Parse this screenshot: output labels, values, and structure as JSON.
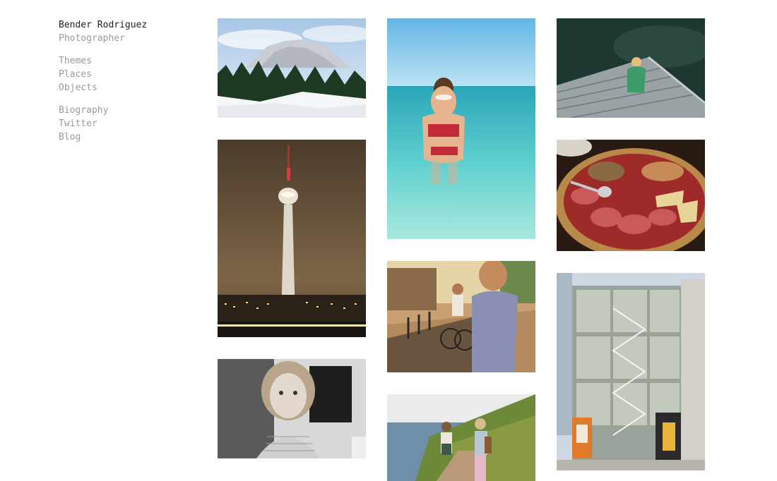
{
  "site": {
    "name": "Bender Rodriguez",
    "subtitle": "Photographer"
  },
  "nav_primary": [
    {
      "label": "Themes"
    },
    {
      "label": "Places"
    },
    {
      "label": "Objects"
    }
  ],
  "nav_secondary": [
    {
      "label": "Biography"
    },
    {
      "label": "Twitter"
    },
    {
      "label": "Blog"
    }
  ],
  "gallery": [
    {
      "subject": "snowy mountain with pine forest",
      "icon": "photo-mountain"
    },
    {
      "subject": "tv tower at night",
      "icon": "photo-tower"
    },
    {
      "subject": "black and white portrait of a girl",
      "icon": "photo-girl"
    },
    {
      "subject": "girl with goggles in turquoise sea",
      "icon": "photo-swimmer"
    },
    {
      "subject": "street with cyclist and man",
      "icon": "photo-street"
    },
    {
      "subject": "two children on coastal path",
      "icon": "photo-hikers"
    },
    {
      "subject": "child sitting on wooden dock",
      "icon": "photo-dock"
    },
    {
      "subject": "platter of cured meats and cheese",
      "icon": "photo-food"
    },
    {
      "subject": "glass building with staircase",
      "icon": "photo-building"
    }
  ],
  "colors": {
    "text_primary": "#222222",
    "text_secondary": "#9a9a9a",
    "background": "#ffffff"
  }
}
